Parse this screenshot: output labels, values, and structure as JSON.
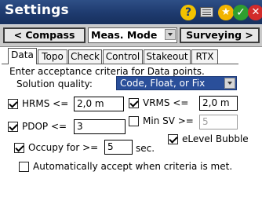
{
  "title": "Settings",
  "titlebar_icons": [
    "help-icon",
    "keyboard-icon",
    "favorites-star-icon",
    "ok-check-icon",
    "close-icon"
  ],
  "nav": {
    "left_button": "< Compass",
    "mode_select": "Meas. Mode",
    "right_button": "Surveying >"
  },
  "tabs": [
    "Data",
    "Topo",
    "Check",
    "Control",
    "Stakeout",
    "RTX"
  ],
  "active_tab": "Data",
  "content": {
    "instruction": "Enter acceptance criteria for Data points.",
    "solution_quality_label": "Solution quality:",
    "solution_quality_value": "Code, Float, or Fix",
    "hrms_label": "HRMS <=",
    "hrms_value": "2,0 m",
    "vrms_label": "VRMS <=",
    "vrms_value": "2,0 m",
    "pdop_label": "PDOP <=",
    "pdop_value": "3",
    "minsv_label": "Min SV >=",
    "minsv_value": "5",
    "elevel_label": "eLevel Bubble",
    "occupy_label": "Occupy for >=",
    "occupy_value": "5",
    "occupy_unit": "sec.",
    "auto_accept_label": "Automatically accept when criteria is met."
  },
  "colors": {
    "titlebar": "#1e3a6e",
    "help": "#f2c200",
    "star": "#f2b400",
    "ok": "#2f9e2f",
    "close": "#d22b2b",
    "selection": "#2a4f9a"
  }
}
